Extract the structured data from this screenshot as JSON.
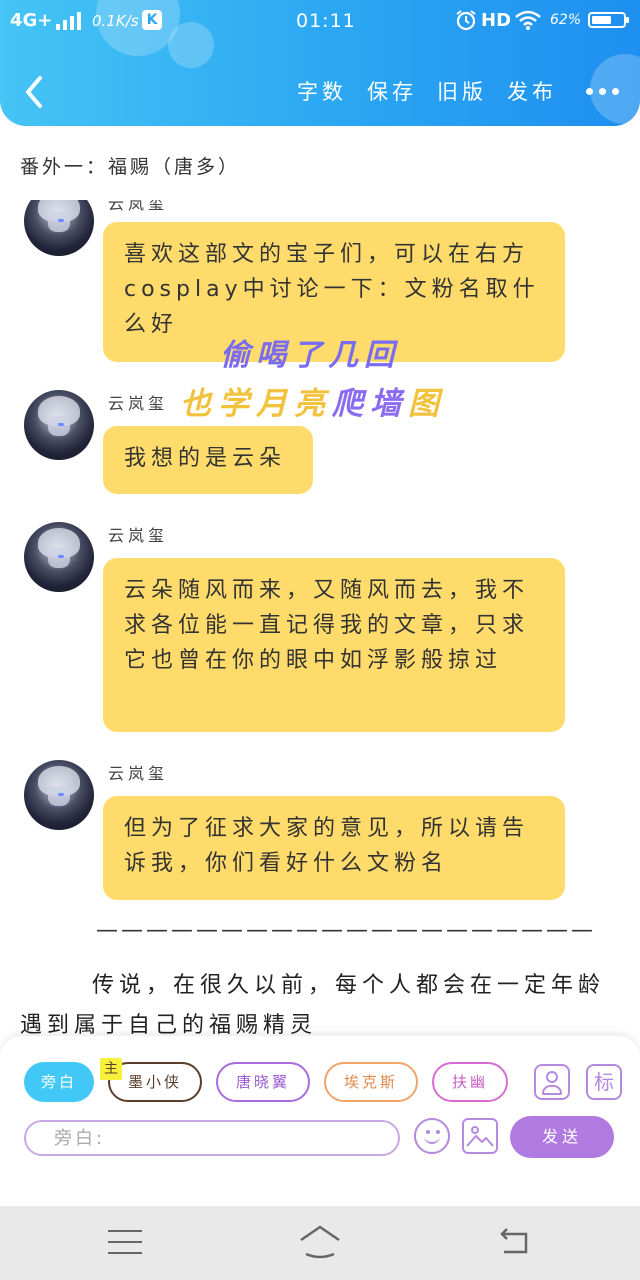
{
  "status_bar": {
    "network": "4G+",
    "speed": "0.1K/s",
    "app_badge": "K",
    "time": "01:11",
    "hd": "HD",
    "battery_text": "62%",
    "battery_level": 0.62
  },
  "header": {
    "actions": [
      "字数",
      "保存",
      "旧版",
      "发布"
    ],
    "colors": {
      "gradient_start": "#45c4f5",
      "gradient_end": "#1e8fef"
    }
  },
  "chapter_title": "番外一：福赐（唐多）",
  "messages": [
    {
      "speaker": "云岚玺",
      "text": "喜欢这部文的宝子们，可以在右方cosplay中讨论一下：文粉名取什么好"
    },
    {
      "speaker": "云岚玺",
      "text": "我想的是云朵"
    },
    {
      "speaker": "云岚玺",
      "text": "云朵随风而来，又随风而去，我不求各位能一直记得我的文章，只求它也曾在你的眼中如浮影般掠过"
    },
    {
      "speaker": "云岚玺",
      "text": "但为了征求大家的意见，所以请告诉我，你们看好什么文粉名"
    }
  ],
  "overlay": {
    "line1": "偷喝了几回",
    "line2_part1": "也学月亮",
    "line2_part2": "爬墙",
    "line2_part3": "图"
  },
  "divider": "————————————————————",
  "narrative": "传说，在很久以前，每个人都会在一定年龄遇到属于自己的福赐精灵",
  "compose": {
    "roles": [
      "旁白",
      "墨小侠",
      "唐晓翼",
      "埃克斯",
      "扶幽"
    ],
    "main_badge": "主",
    "tag_label": "标",
    "input_placeholder": "旁白:",
    "send_label": "发送",
    "colors": {
      "bubble": "#fedb6a",
      "send": "#b07ae0",
      "active_role": "#42c8f7"
    }
  }
}
